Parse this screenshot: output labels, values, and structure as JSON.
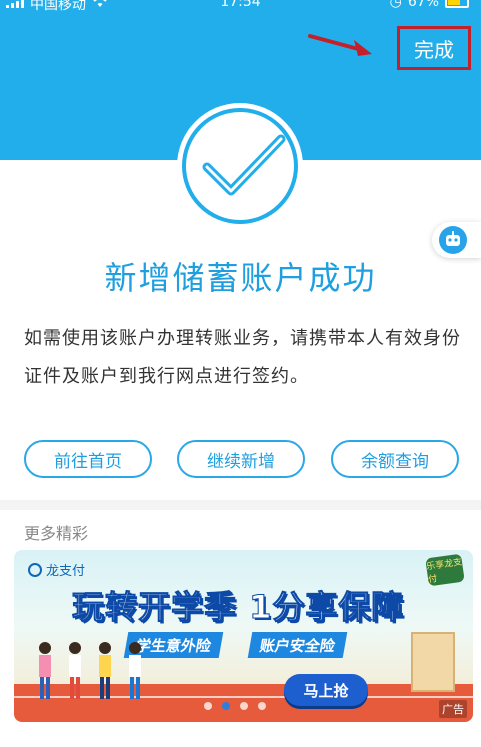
{
  "status_bar": {
    "carrier": "中国移动",
    "time": "17:54",
    "battery": "67%",
    "battery_level": 0.67
  },
  "header": {
    "done_label": "完成"
  },
  "result": {
    "title": "新增储蓄账户成功",
    "description": "如需使用该账户办理转账业务，请携带本人有效身份证件及账户到我行网点进行签约。"
  },
  "actions": {
    "home_label": "前往首页",
    "continue_label": "继续新增",
    "balance_label": "余额查询"
  },
  "more": {
    "label": "更多精彩"
  },
  "banner": {
    "logo_text": "龙支付",
    "corner_text": "乐享龙支付",
    "headline": "玩转开学季 1分享保障",
    "tag_1": "学生意外险",
    "tag_2": "账户安全险",
    "cta": "马上抢",
    "ad_label": "广告",
    "page_count": 4,
    "active_page": 1
  },
  "colors": {
    "primary": "#22aeea",
    "accent_text": "#1f9fe0",
    "highlight": "#c4202a"
  }
}
